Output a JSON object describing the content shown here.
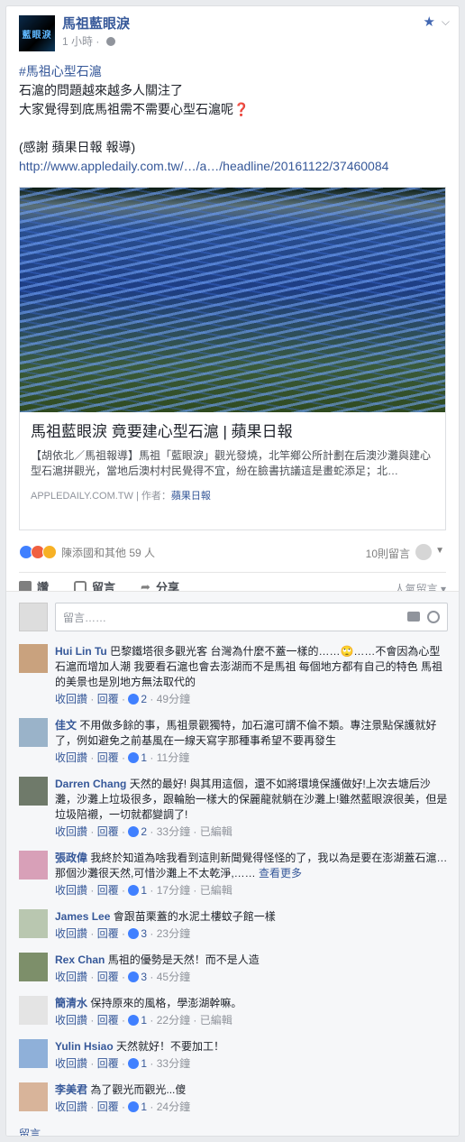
{
  "post": {
    "page_name": "馬祖藍眼淚",
    "avatar_text": "藍眼淚",
    "time": "1 小時",
    "hashtag": "#馬祖心型石滬",
    "lines": [
      "石滬的問題越來越多人關注了",
      "大家覺得到底馬祖需不需要心型石滬呢"
    ],
    "thanks": "(感謝 蘋果日報 報導)",
    "link": "http://www.appledaily.com.tw/…/a…/headline/20161122/37460084"
  },
  "share": {
    "title": "馬祖藍眼淚 竟要建心型石滬 | 蘋果日報",
    "description": "【胡依北／馬祖報導】馬祖「藍眼淚」觀光發燒，北竿鄉公所計劃在后澳沙灘與建心型石滬拼觀光，當地后澳村村民覺得不宜，紛在臉書抗議這是畫蛇添足；北…",
    "domain": "APPLEDAILY.COM.TW",
    "author_label": "作者：",
    "author": "蘋果日報"
  },
  "reactions": {
    "names": "陳添國和其他 59 人",
    "comment_count": "10則留言"
  },
  "actions": {
    "like": "讚",
    "comment": "留言",
    "share": "分享",
    "sort": "人氣留言 ▾"
  },
  "composer": {
    "placeholder": "留言……"
  },
  "comments": [
    {
      "author": "Hui Lin Tu",
      "text": "巴黎鐵塔很多觀光客 台灣為什麼不蓋一樣的……🙄……不會因為心型石滬而增加人潮 我要看石滬也會去澎湖而不是馬祖 每個地方都有自己的特色 馬祖的美景也是別地方無法取代的",
      "unlike": "收回讚",
      "reply": "回覆",
      "likes": "2",
      "time": "49分鐘",
      "edited": "",
      "avatar_color": "#c9a27e"
    },
    {
      "author": "佳文",
      "text": "不用做多餘的事，馬祖景觀獨特，加石滬可謂不倫不類。專注景點保護就好了，例如避免之前基風在一線天寫字那種事希望不要再發生",
      "unlike": "收回讚",
      "reply": "回覆",
      "likes": "1",
      "time": "11分鐘",
      "edited": "",
      "avatar_color": "#9ab3c9"
    },
    {
      "author": "Darren Chang",
      "text": "天然的最好! 與其用這個，還不如將環境保護做好!上次去塘后沙灘，沙灘上垃圾很多，跟輪胎一樣大的保麗龍就躺在沙灘上!雖然藍眼淚很美，但是垃圾陪襯，一切就都變調了!",
      "unlike": "收回讚",
      "reply": "回覆",
      "likes": "2",
      "time": "33分鐘",
      "edited": "已編輯",
      "avatar_color": "#6f7a6a"
    },
    {
      "author": "張政偉",
      "text": "我終於知道為啥我看到這則新聞覺得怪怪的了，我以為是要在澎湖蓋石滬…那個沙灘很天然,可惜沙灘上不太乾淨,……",
      "see_more": "查看更多",
      "unlike": "收回讚",
      "reply": "回覆",
      "likes": "1",
      "time": "17分鐘",
      "edited": "已編輯",
      "avatar_color": "#d8a0b8"
    },
    {
      "author": "James Lee",
      "text": "會跟苗栗蓋的水泥土樓蚊子館一樣",
      "unlike": "收回讚",
      "reply": "回覆",
      "likes": "3",
      "time": "23分鐘",
      "edited": "",
      "avatar_color": "#b9c7b0"
    },
    {
      "author": "Rex Chan",
      "text": "馬祖的優勢是天然！而不是人造",
      "unlike": "收回讚",
      "reply": "回覆",
      "likes": "3",
      "time": "45分鐘",
      "edited": "",
      "avatar_color": "#7d8f6a"
    },
    {
      "author": "簡清水",
      "text": "保持原來的風格，學澎湖幹嘛。",
      "unlike": "收回讚",
      "reply": "回覆",
      "likes": "1",
      "time": "22分鐘",
      "edited": "已編輯",
      "avatar_color": "#e4e4e4"
    },
    {
      "author": "Yulin Hsiao",
      "text": "天然就好！不要加工！",
      "unlike": "收回讚",
      "reply": "回覆",
      "likes": "1",
      "time": "33分鐘",
      "edited": "",
      "avatar_color": "#8fb0d9"
    },
    {
      "author": "李美君",
      "text": "為了觀光而觀光...傻",
      "unlike": "收回讚",
      "reply": "回覆",
      "likes": "1",
      "time": "24分鐘",
      "edited": "",
      "avatar_color": "#d8b49a"
    }
  ],
  "more_comments": "留言……"
}
